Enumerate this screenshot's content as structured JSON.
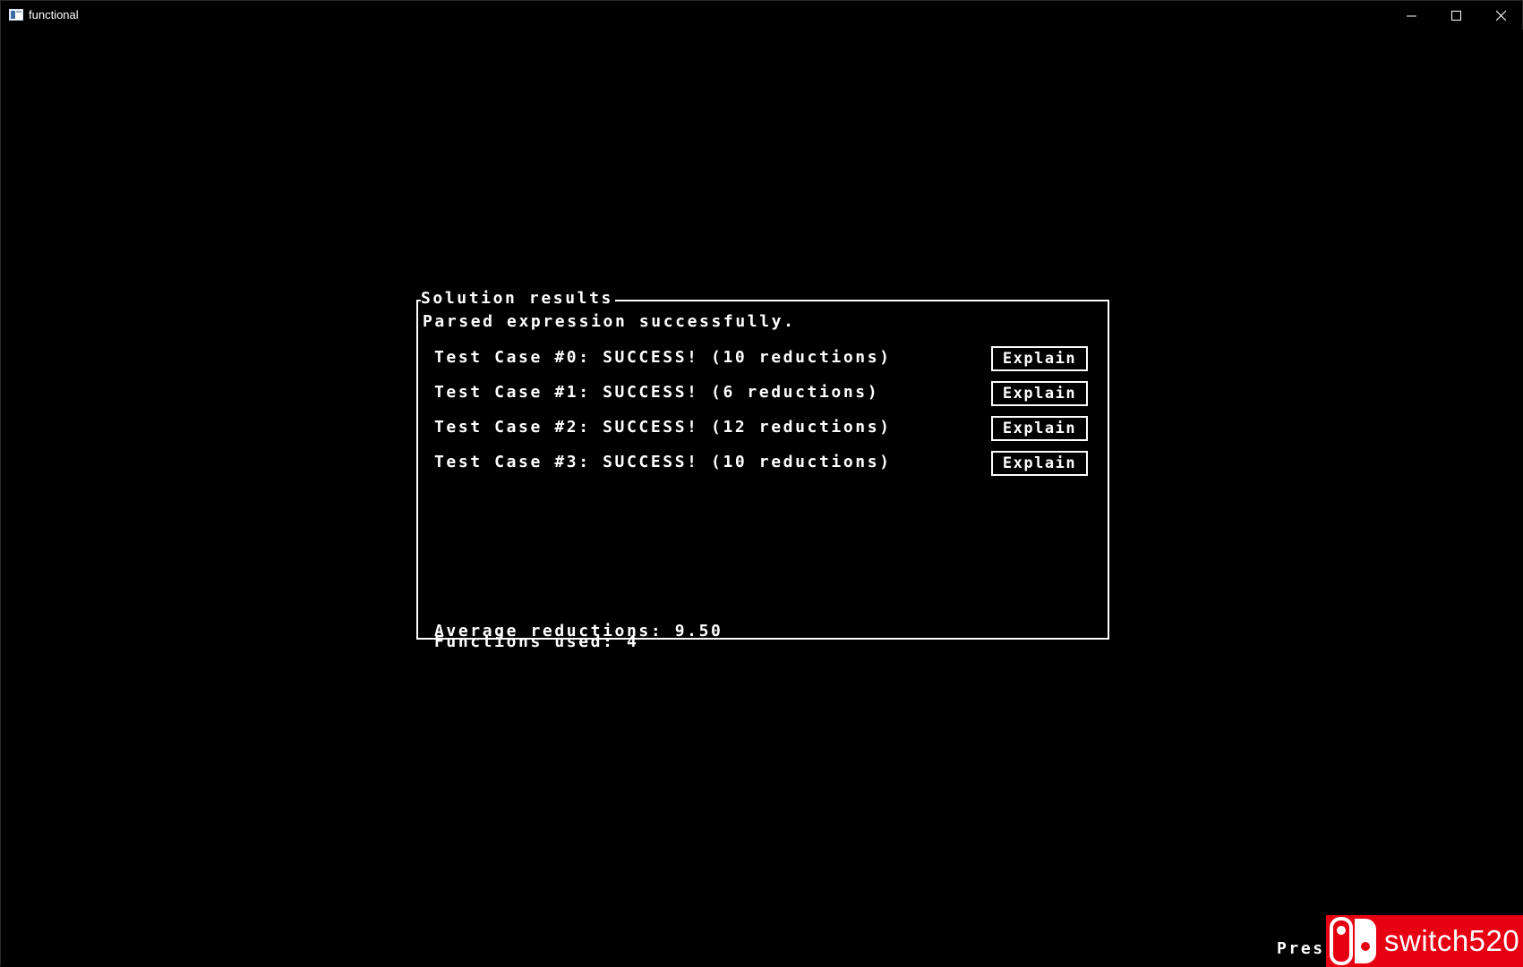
{
  "window": {
    "title": "functional"
  },
  "panel": {
    "title": "Solution results",
    "status": "Parsed expression successfully.",
    "test_cases": [
      {
        "text": "Test Case #0: SUCCESS! (10 reductions)",
        "button": "Explain"
      },
      {
        "text": "Test Case #1: SUCCESS! (6 reductions)",
        "button": "Explain"
      },
      {
        "text": "Test Case #2: SUCCESS! (12 reductions)",
        "button": "Explain"
      },
      {
        "text": "Test Case #3: SUCCESS! (10 reductions)",
        "button": "Explain"
      }
    ],
    "average_reductions": "Average reductions: 9.50",
    "functions_used": "Functions used: 4"
  },
  "footer": {
    "press_text": "Pres"
  },
  "watermark": {
    "text": "switch520",
    "color": "#e60012"
  },
  "icons": {
    "app": "app-window-icon",
    "minimize": "minimize-icon",
    "maximize": "maximize-icon",
    "close": "close-icon",
    "watermark_logo": "switch-logo-icon"
  }
}
